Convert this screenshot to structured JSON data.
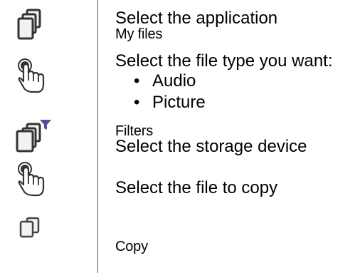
{
  "steps": {
    "s1_line1": "Select the application",
    "s1_line2": "My files",
    "s2_line1": "Select the file type you want:",
    "s2_bullets": [
      "Audio",
      "Picture"
    ],
    "s3_line1": "Filters",
    "s3_line2": "Select the storage device",
    "s4_line1": "Select the file to copy",
    "s5_line1": "Copy"
  },
  "icons": {
    "i1": "stacked-files-icon",
    "i2": "tap-gesture-icon",
    "i3": "files-filter-icon",
    "i4": "tap-gesture-icon",
    "i5": "copy-icon"
  },
  "colors": {
    "icon_fill": "#f2f2f2",
    "icon_stroke": "#333333",
    "filter_accent": "#5a4c9a"
  }
}
